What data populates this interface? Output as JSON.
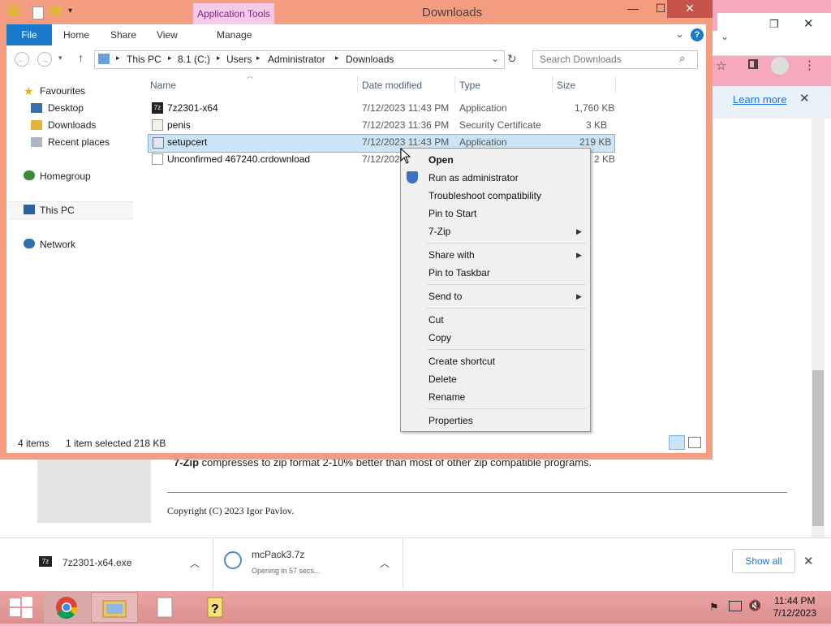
{
  "explorer": {
    "title": "Downloads",
    "app_tools": "Application Tools",
    "ribbon_tabs": [
      "File",
      "Home",
      "Share",
      "View",
      "Manage"
    ],
    "address": [
      "This PC",
      "8.1 (C:)",
      "Users",
      "Administrator",
      "Downloads"
    ],
    "search_placeholder": "Search Downloads",
    "nav": {
      "favourites": "Favourites",
      "desktop": "Desktop",
      "downloads": "Downloads",
      "recent": "Recent places",
      "homegroup": "Homegroup",
      "thispc": "This PC",
      "network": "Network"
    },
    "columns": [
      "Name",
      "Date modified",
      "Type",
      "Size"
    ],
    "files": [
      {
        "name": "7z2301-x64",
        "date": "7/12/2023 11:43 PM",
        "type": "Application",
        "size": "1,760 KB"
      },
      {
        "name": "penis",
        "date": "7/12/2023 11:36 PM",
        "type": "Security Certificate",
        "size": "3 KB"
      },
      {
        "name": "setupcert",
        "date": "7/12/2023 11:43 PM",
        "type": "Application",
        "size": "219 KB"
      },
      {
        "name": "Unconfirmed 467240.crdownload",
        "date": "7/12/202",
        "type": "",
        "size": "2 KB"
      }
    ],
    "status": {
      "items": "4 items",
      "selected": "1 item selected  218 KB"
    }
  },
  "context_menu": {
    "open": "Open",
    "run_admin": "Run as administrator",
    "troubleshoot": "Troubleshoot compatibility",
    "pin_start": "Pin to Start",
    "zip": "7-Zip",
    "share_with": "Share with",
    "pin_taskbar": "Pin to Taskbar",
    "send_to": "Send to",
    "cut": "Cut",
    "copy": "Copy",
    "create_shortcut": "Create shortcut",
    "delete": "Delete",
    "rename": "Rename",
    "properties": "Properties"
  },
  "chrome": {
    "learn_more": "Learn more"
  },
  "webpage": {
    "desc_bold": "7-Zip",
    "desc_rest": " compresses to zip format 2-10% better than most of other zip compatible programs.",
    "copyright": "Copyright (C) 2023 Igor Pavlov."
  },
  "downloads_bar": {
    "item1": "7z2301-x64.exe",
    "item2": "mcPack3.7z",
    "item2_status": "Opening in 57 secs...",
    "show_all": "Show all"
  },
  "taskbar": {
    "time": "11:44 PM",
    "date": "7/12/2023"
  }
}
